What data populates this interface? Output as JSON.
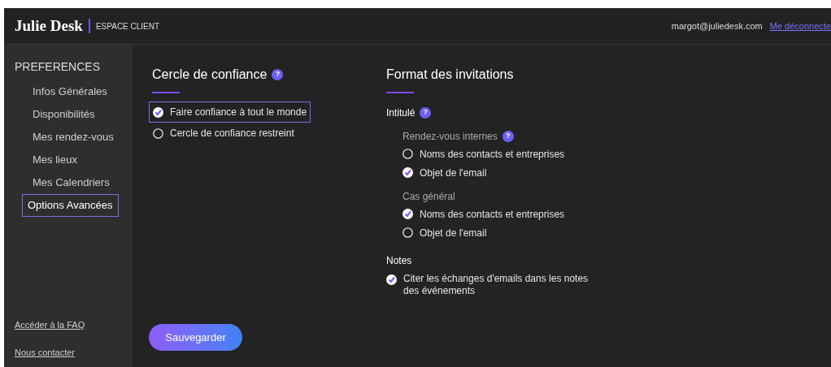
{
  "header": {
    "logo": "Julie Desk",
    "section": "ESPACE CLIENT",
    "email": "margot@juliedesk.com",
    "logout": "Me déconnecte"
  },
  "sidebar": {
    "heading": "PREFERENCES",
    "items": [
      {
        "label": "Infos Générales",
        "selected": false
      },
      {
        "label": "Disponibilités",
        "selected": false
      },
      {
        "label": "Mes rendez-vous",
        "selected": false
      },
      {
        "label": "Mes lieux",
        "selected": false
      },
      {
        "label": "Mes Calendriers",
        "selected": false
      },
      {
        "label": "Options Avancées",
        "selected": true
      }
    ],
    "footer_links": [
      "Accéder à la FAQ",
      "Nous contacter"
    ]
  },
  "trust": {
    "title": "Cercle de confiance",
    "help": "?",
    "options": [
      {
        "label": "Faire confiance à tout le monde",
        "selected": true,
        "focused": true
      },
      {
        "label": "Cercle de confiance restreint",
        "selected": false,
        "focused": false
      }
    ]
  },
  "format": {
    "title": "Format des invitations",
    "intitule": {
      "label": "Intitulé",
      "help": "?"
    },
    "groups": [
      {
        "title": "Rendez-vous internes",
        "help": "?",
        "options": [
          {
            "label": "Noms des contacts et entreprises",
            "selected": false
          },
          {
            "label": "Objet de l'email",
            "selected": true
          }
        ]
      },
      {
        "title": "Cas général",
        "options": [
          {
            "label": "Noms des contacts et entreprises",
            "selected": true
          },
          {
            "label": "Objet de l'email",
            "selected": false
          }
        ]
      }
    ],
    "notes": {
      "title": "Notes",
      "options": [
        {
          "label": "Citer les échanges d'emails dans les notes des événements",
          "checked": true
        }
      ]
    }
  },
  "save_button": "Sauvegarder"
}
